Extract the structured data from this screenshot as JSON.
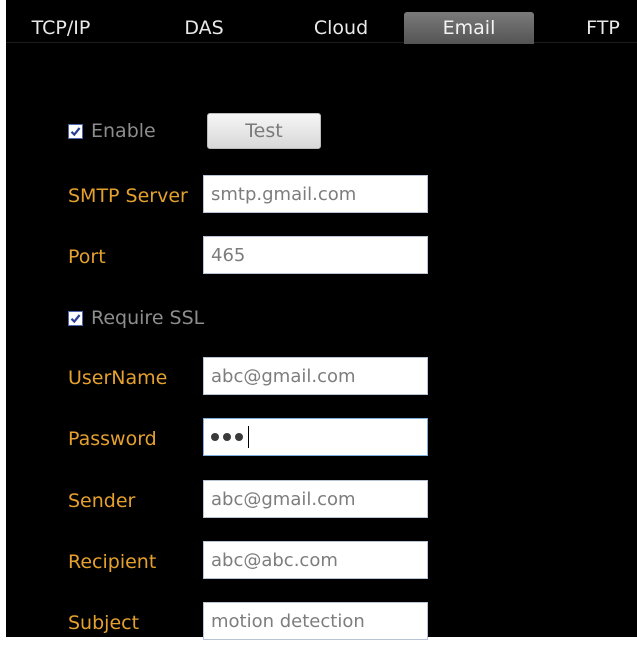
{
  "tabs": [
    {
      "label": "TCP/IP",
      "active": false
    },
    {
      "label": "DAS",
      "active": false
    },
    {
      "label": "Cloud",
      "active": false
    },
    {
      "label": "Email",
      "active": true
    },
    {
      "label": "FTP",
      "active": false
    }
  ],
  "email": {
    "enable": {
      "label": "Enable",
      "checked": true
    },
    "test_button": "Test",
    "smtp_server": {
      "label": "SMTP Server",
      "value": "smtp.gmail.com"
    },
    "port": {
      "label": "Port",
      "value": "465"
    },
    "require_ssl": {
      "label": "Require SSL",
      "checked": true
    },
    "username": {
      "label": "UserName",
      "value": "abc@gmail.com"
    },
    "password": {
      "label": "Password",
      "masked_length": 3
    },
    "sender": {
      "label": "Sender",
      "value": "abc@gmail.com"
    },
    "recipient": {
      "label": "Recipient",
      "value": "abc@abc.com"
    },
    "subject": {
      "label": "Subject",
      "value": "motion detection"
    }
  },
  "colors": {
    "background": "#000000",
    "label": "#e5a12e",
    "disabled_text": "#8d8d8d",
    "active_tab": "#6a6a6a",
    "tab_text": "#e9e9e9"
  }
}
